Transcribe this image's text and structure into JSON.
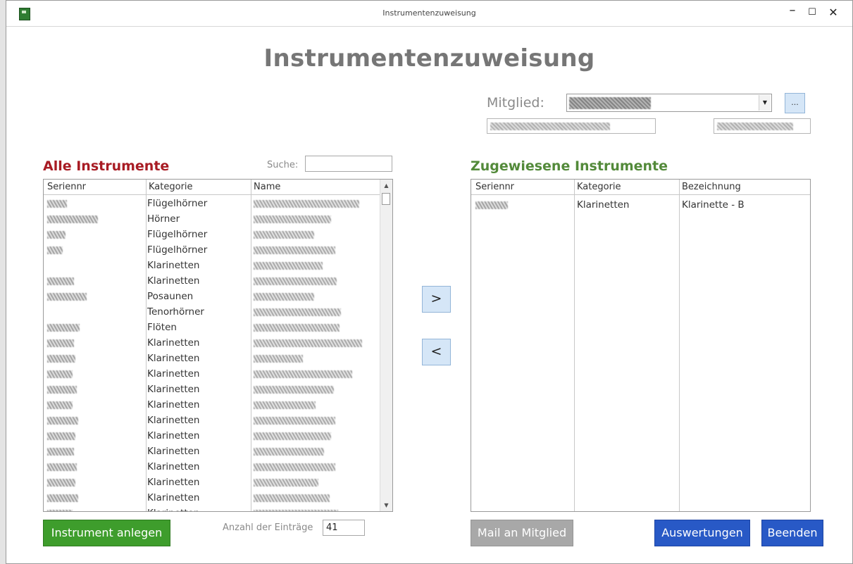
{
  "window": {
    "title": "Instrumentenzuweisung",
    "minimize": "–",
    "maximize": "☐",
    "close": "✕",
    "icon": "app-icon"
  },
  "page": {
    "title": "Instrumentenzuweisung"
  },
  "member": {
    "label": "Mitglied:",
    "dropdown_arrow": "▼",
    "more_label": "..."
  },
  "left": {
    "heading": "Alle Instrumente",
    "search_label": "Suche:",
    "columns": [
      "Seriennr",
      "Kategorie",
      "Name"
    ],
    "rows": [
      {
        "kategorie": "Flügelhörner"
      },
      {
        "kategorie": "Hörner"
      },
      {
        "kategorie": "Flügelhörner"
      },
      {
        "kategorie": "Flügelhörner"
      },
      {
        "kategorie": "Klarinetten"
      },
      {
        "kategorie": "Klarinetten"
      },
      {
        "kategorie": "Posaunen"
      },
      {
        "kategorie": "Tenorhörner"
      },
      {
        "kategorie": "Flöten"
      },
      {
        "kategorie": "Klarinetten"
      },
      {
        "kategorie": "Klarinetten"
      },
      {
        "kategorie": "Klarinetten"
      },
      {
        "kategorie": "Klarinetten"
      },
      {
        "kategorie": "Klarinetten"
      },
      {
        "kategorie": "Klarinetten"
      },
      {
        "kategorie": "Klarinetten"
      },
      {
        "kategorie": "Klarinetten"
      },
      {
        "kategorie": "Klarinetten"
      },
      {
        "kategorie": "Klarinetten"
      },
      {
        "kategorie": "Klarinetten"
      },
      {
        "kategorie": "Klarinetten"
      }
    ],
    "scroll_up": "▲",
    "scroll_down": "▼",
    "count_label": "Anzahl der Einträge",
    "count_value": "41",
    "create_button": "Instrument anlegen"
  },
  "right": {
    "heading": "Zugewiesene Instrumente",
    "columns": [
      "Seriennr",
      "Kategorie",
      "Bezeichnung"
    ],
    "rows": [
      {
        "kategorie": "Klarinetten",
        "bezeichnung": "Klarinette - B"
      }
    ]
  },
  "transfer": {
    "assign": ">",
    "unassign": "<"
  },
  "buttons": {
    "mail": "Mail an Mitglied",
    "reports": "Auswertungen",
    "close": "Beenden"
  },
  "colors": {
    "left_heading": "#a81c24",
    "right_heading": "#538a3a",
    "green_button": "#3e9d2c",
    "blue_button": "#2859c6",
    "gray_button": "#a8a8a8"
  }
}
